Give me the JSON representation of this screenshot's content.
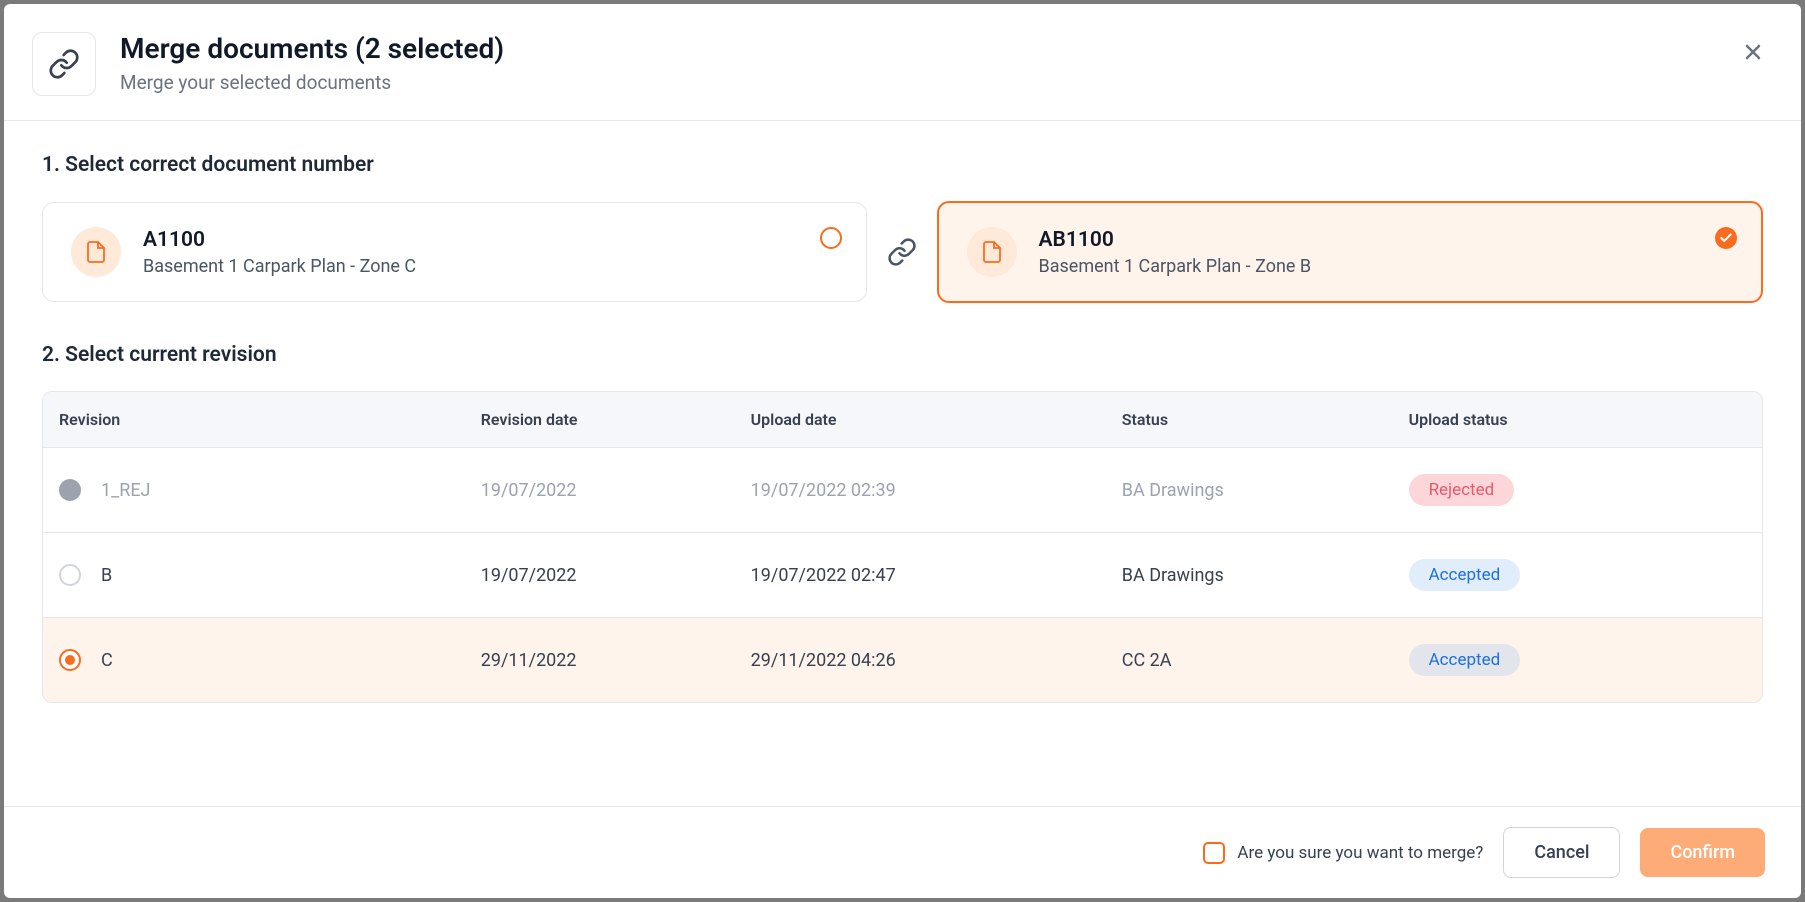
{
  "header": {
    "title": "Merge documents (2 selected)",
    "subtitle": "Merge your selected documents"
  },
  "section1": {
    "title": "1. Select correct document number",
    "docs": [
      {
        "number": "A1100",
        "description": "Basement 1 Carpark Plan - Zone C",
        "selected": false
      },
      {
        "number": "AB1100",
        "description": "Basement 1 Carpark Plan - Zone B",
        "selected": true
      }
    ]
  },
  "section2": {
    "title": "2. Select current revision",
    "columns": {
      "revision": "Revision",
      "revision_date": "Revision date",
      "upload_date": "Upload date",
      "status": "Status",
      "upload_status": "Upload status"
    },
    "rows": [
      {
        "revision": "1_REJ",
        "revision_date": "19/07/2022",
        "upload_date": "19/07/2022 02:39",
        "status": "BA Drawings",
        "upload_status": "Rejected",
        "state": "disabled"
      },
      {
        "revision": "B",
        "revision_date": "19/07/2022",
        "upload_date": "19/07/2022 02:47",
        "status": "BA Drawings",
        "upload_status": "Accepted",
        "state": "default"
      },
      {
        "revision": "C",
        "revision_date": "29/11/2022",
        "upload_date": "29/11/2022 04:26",
        "status": "CC 2A",
        "upload_status": "Accepted",
        "state": "selected"
      }
    ]
  },
  "footer": {
    "confirm_label": "Are you sure you want to merge?",
    "cancel": "Cancel",
    "confirm": "Confirm"
  }
}
